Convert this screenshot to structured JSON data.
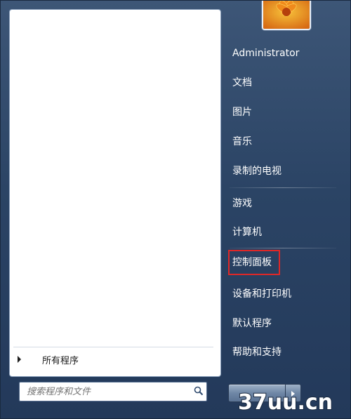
{
  "left_pane": {
    "all_programs_label": "所有程序",
    "search": {
      "placeholder": "搜索程序和文件"
    }
  },
  "right_pane": {
    "items": [
      {
        "label": "Administrator"
      },
      {
        "label": "文档"
      },
      {
        "label": "图片"
      },
      {
        "label": "音乐"
      },
      {
        "label": "录制的电视"
      },
      {
        "label": "游戏"
      },
      {
        "label": "计算机"
      },
      {
        "label": "控制面板"
      },
      {
        "label": "设备和打印机"
      },
      {
        "label": "默认程序"
      },
      {
        "label": "帮助和支持"
      }
    ]
  },
  "highlighted_item": "控制面板",
  "watermark": {
    "text": "37uu.cn"
  },
  "colors": {
    "highlight_border": "#e02727",
    "menu_background": "#2b4465"
  },
  "icons": [
    "user-picture-flower",
    "arrow-right-icon",
    "search-icon",
    "power-icon"
  ]
}
